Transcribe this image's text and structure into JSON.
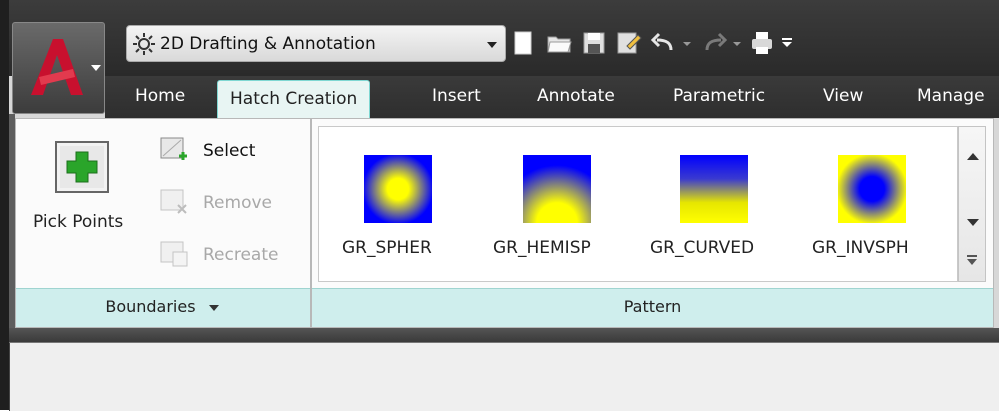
{
  "workspace": {
    "label": "2D Drafting & Annotation"
  },
  "tabs": [
    {
      "label": "Home"
    },
    {
      "label": "Hatch Creation"
    },
    {
      "label": "Insert"
    },
    {
      "label": "Annotate"
    },
    {
      "label": "Parametric"
    },
    {
      "label": "View"
    },
    {
      "label": "Manage"
    }
  ],
  "boundaries": {
    "pick_points": "Pick Points",
    "select": "Select",
    "remove": "Remove",
    "recreate": "Recreate",
    "footer": "Boundaries"
  },
  "pattern": {
    "footer": "Pattern",
    "items": [
      {
        "label": "GR_SPHER"
      },
      {
        "label": "GR_HEMISP"
      },
      {
        "label": "GR_CURVED"
      },
      {
        "label": "GR_INVSPH"
      }
    ]
  },
  "colors": {
    "accent_teal": "#7fd7d2",
    "gradient_blue": "#0000ff",
    "gradient_yellow": "#ffff00",
    "app_red": "#c8102e"
  },
  "icons": {
    "app": "autocad-a-logo",
    "workspace": "gear-icon",
    "qat": [
      "new-icon",
      "open-icon",
      "save-icon",
      "save-as-icon",
      "undo-icon",
      "undo-dropdown-icon",
      "redo-icon",
      "redo-dropdown-icon",
      "plot-icon",
      "customize-dropdown-icon"
    ],
    "pick_points": "plus-icon",
    "select": "select-objects-icon",
    "remove": "remove-boundaries-icon",
    "recreate": "recreate-boundary-icon",
    "scroll_up": "arrow-up-icon",
    "scroll_down": "arrow-down-icon",
    "scroll_more": "more-icon"
  }
}
